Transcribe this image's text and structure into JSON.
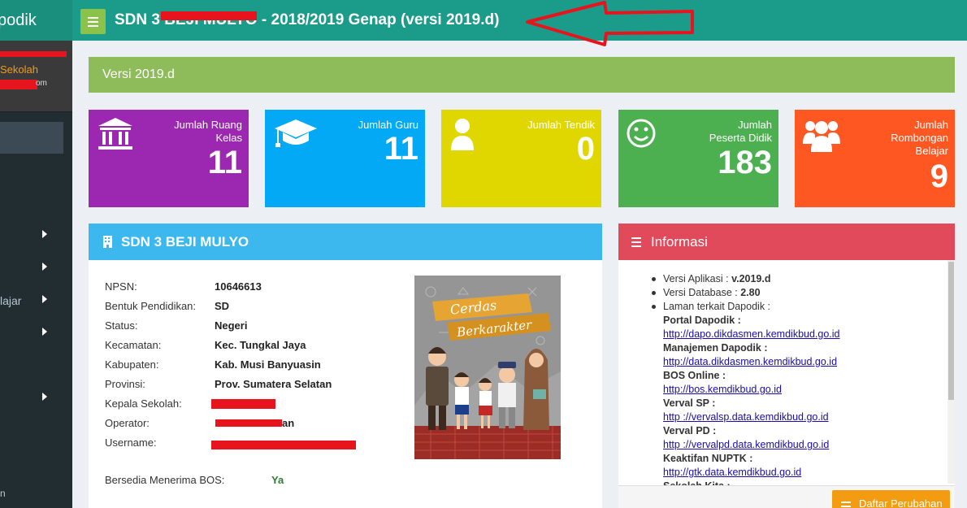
{
  "app": {
    "brand": "podik"
  },
  "sidebar": {
    "school_label": "Sekolah",
    "email_tail": "om",
    "items": [
      {
        "label": ""
      },
      {
        "label": ""
      },
      {
        "label": "lajar"
      },
      {
        "label": ""
      },
      {
        "label": ""
      }
    ],
    "footer": "n"
  },
  "header": {
    "title": "SDN 3 BEJI MULYO - 2018/2019 Genap (versi 2019.d)"
  },
  "version_banner": "Versi 2019.d",
  "stats": [
    {
      "label": "Jumlah Ruang Kelas",
      "value": "11",
      "color": "#9c27b0",
      "icon": "bank-icon"
    },
    {
      "label": "Jumlah Guru",
      "value": "11",
      "color": "#03a9f4",
      "icon": "graduation-cap-icon"
    },
    {
      "label": "Jumlah Tendik",
      "value": "0",
      "color": "#e1d700",
      "icon": "user-icon"
    },
    {
      "label": "Jumlah Peserta Didik",
      "value": "183",
      "color": "#4caf50",
      "icon": "smile-icon"
    },
    {
      "label": "Jumlah Rombongan Belajar",
      "value": "9",
      "color": "#ff5722",
      "icon": "users-icon"
    }
  ],
  "school": {
    "title": "SDN 3 BEJI MULYO",
    "fields": [
      {
        "key": "NPSN:",
        "value": "10646613"
      },
      {
        "key": "Bentuk Pendidikan:",
        "value": "SD"
      },
      {
        "key": "Status:",
        "value": "Negeri"
      },
      {
        "key": "Kecamatan:",
        "value": "Kec. Tungkal Jaya"
      },
      {
        "key": "Kabupaten:",
        "value": "Kab. Musi Banyuasin"
      },
      {
        "key": "Provinsi:",
        "value": "Prov. Sumatera Selatan"
      },
      {
        "key": "Kepala Sekolah:",
        "value": ""
      },
      {
        "key": "Operator:",
        "value": "an"
      },
      {
        "key": "Username:",
        "value": ""
      }
    ],
    "bos_label": "Bersedia Menerima BOS:",
    "bos_value": "Ya",
    "poster_text_1": "Cerdas",
    "poster_text_2": "Berkarakter"
  },
  "info": {
    "title": "Informasi",
    "app_version_label": "Versi Aplikasi :",
    "app_version": "v.2019.d",
    "db_version_label": "Versi Database :",
    "db_version": "2.80",
    "links_label": "Laman terkait Dapodik :",
    "links": [
      {
        "name": "Portal Dapodik :",
        "url": "http://dapo.dikdasmen.kemdikbud.go.id"
      },
      {
        "name": "Manajemen Dapodik :",
        "url": "http://data.dikdasmen.kemdikbud.go.id"
      },
      {
        "name": "BOS Online :",
        "url": "http://bos.kemdikbud.go.id"
      },
      {
        "name": "Verval SP :",
        "url": "http ://vervalsp.data.kemdikbud.go.id"
      },
      {
        "name": "Verval PD :",
        "url": "http ://vervalpd.data.kemdikbud.go.id"
      },
      {
        "name": "Keaktifan NUPTK :",
        "url": "http://gtk.data.kemdikbud.go.id"
      },
      {
        "name": "Sekolah Kita :",
        "url": ""
      }
    ],
    "changes_button": "Daftar Perubahan"
  }
}
